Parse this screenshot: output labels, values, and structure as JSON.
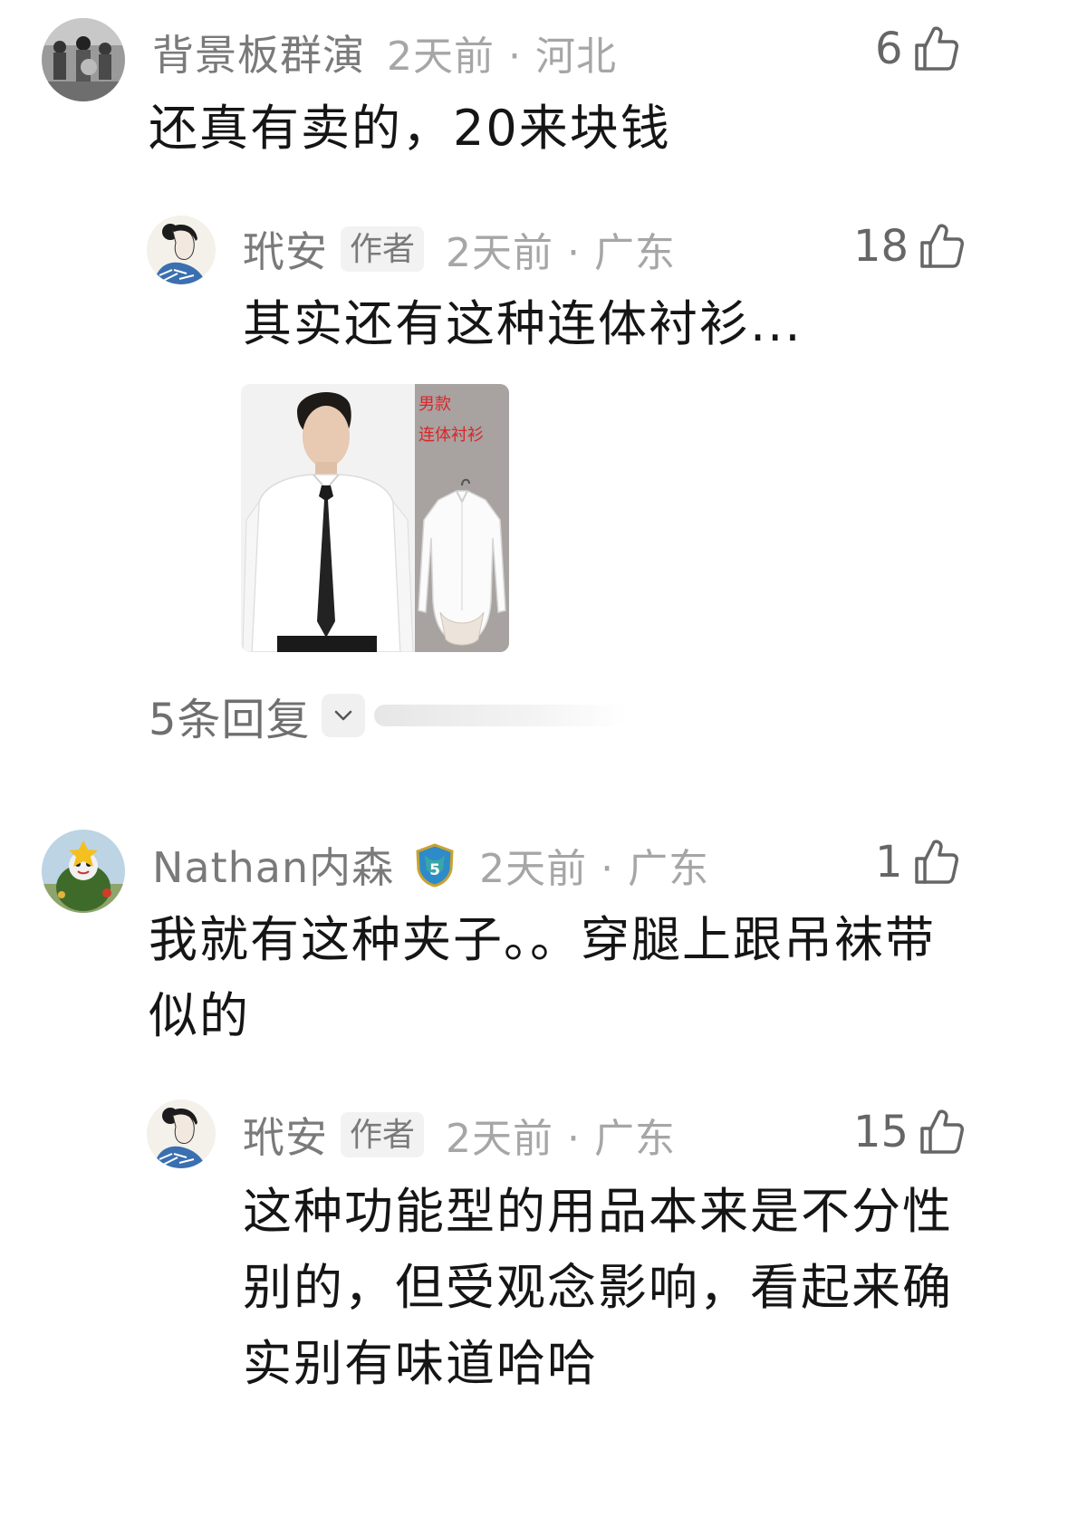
{
  "comments": [
    {
      "username": "背景板群演",
      "time_location": "2天前 · 河北",
      "likes": "6",
      "text": "还真有卖的，20来块钱",
      "avatar_icon": "crowd-photo-avatar"
    },
    {
      "username": "玳安",
      "author_tag": "作者",
      "time_location": "2天前 · 广东",
      "likes": "18",
      "text": "其实还有这种连体衬衫...",
      "avatar_icon": "ink-portrait-avatar",
      "image": {
        "label_line1": "男款",
        "label_line2": "连体衬衫"
      },
      "replies": "5条回复"
    },
    {
      "username": "Nathan内森",
      "level_badge": "5",
      "time_location": "2天前 · 广东",
      "likes": "1",
      "text": "我就有这种夹子。。穿腿上跟吊袜带似的",
      "avatar_icon": "plush-toy-avatar"
    },
    {
      "username": "玳安",
      "author_tag": "作者",
      "time_location": "2天前 · 广东",
      "likes": "15",
      "text": "这种功能型的用品本来是不分性别的，但受观念影响，看起来确实别有味道哈哈",
      "avatar_icon": "ink-portrait-avatar"
    }
  ],
  "colors": {
    "username": "#7a7a7a",
    "meta": "#a6a6a6",
    "text": "#151515",
    "like": "#666666"
  }
}
